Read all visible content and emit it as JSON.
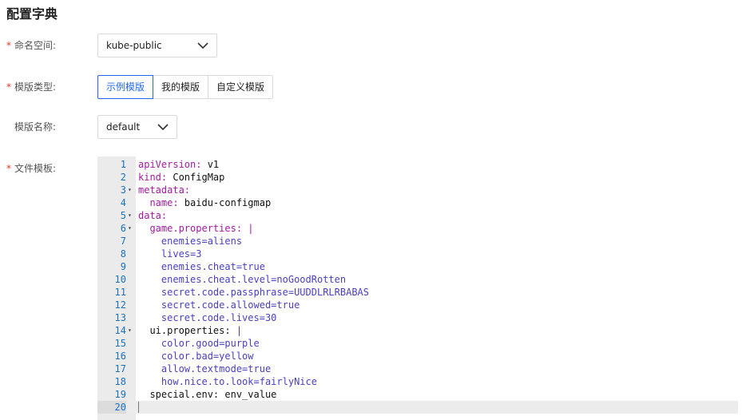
{
  "page": {
    "title": "配置字典"
  },
  "form": {
    "namespace": {
      "label": "命名空间:",
      "value": "kube-public",
      "required": true
    },
    "template_type": {
      "label": "模版类型:",
      "required": true,
      "options": [
        "示例模版",
        "我的模版",
        "自定义模版"
      ],
      "selected": "示例模版"
    },
    "template_name": {
      "label": "模版名称:",
      "value": "default",
      "required": false
    },
    "file_template": {
      "label": "文件模板:",
      "required": true
    }
  },
  "editor": {
    "lines": [
      {
        "n": "1",
        "fold": "",
        "key": "apiVersion:",
        "val": " v1",
        "indent": ""
      },
      {
        "n": "2",
        "fold": "",
        "key": "kind:",
        "val": " ConfigMap",
        "indent": ""
      },
      {
        "n": "3",
        "fold": "▾",
        "key": "metadata:",
        "val": "",
        "indent": ""
      },
      {
        "n": "4",
        "fold": "",
        "key": "name:",
        "val": " baidu-configmap",
        "indent": "  "
      },
      {
        "n": "5",
        "fold": "▾",
        "key": "data:",
        "val": "",
        "indent": ""
      },
      {
        "n": "6",
        "fold": "▾",
        "key": "game.properties: |",
        "val": "",
        "indent": "  "
      },
      {
        "n": "7",
        "fold": "",
        "key": "",
        "val": "enemies=aliens",
        "indent": "    ",
        "plain": true
      },
      {
        "n": "8",
        "fold": "",
        "key": "",
        "val": "lives=3",
        "indent": "    ",
        "plain": true
      },
      {
        "n": "9",
        "fold": "",
        "key": "",
        "val": "enemies.cheat=true",
        "indent": "    ",
        "plain": true
      },
      {
        "n": "10",
        "fold": "",
        "key": "",
        "val": "enemies.cheat.level=noGoodRotten",
        "indent": "    ",
        "plain": true
      },
      {
        "n": "11",
        "fold": "",
        "key": "",
        "val": "secret.code.passphrase=UUDDLRLRBABAS",
        "indent": "    ",
        "plain": true
      },
      {
        "n": "12",
        "fold": "",
        "key": "",
        "val": "secret.code.allowed=true",
        "indent": "    ",
        "plain": true
      },
      {
        "n": "13",
        "fold": "",
        "key": "",
        "val": "secret.code.lives=30",
        "indent": "    ",
        "plain": true
      },
      {
        "n": "14",
        "fold": "▾",
        "key": "",
        "val": "ui.properties: |",
        "indent": "  ",
        "mixed": true
      },
      {
        "n": "15",
        "fold": "",
        "key": "",
        "val": "color.good=purple",
        "indent": "    ",
        "plain": true
      },
      {
        "n": "16",
        "fold": "",
        "key": "",
        "val": "color.bad=yellow",
        "indent": "    ",
        "plain": true
      },
      {
        "n": "17",
        "fold": "",
        "key": "",
        "val": "allow.textmode=true",
        "indent": "    ",
        "plain": true
      },
      {
        "n": "18",
        "fold": "",
        "key": "",
        "val": "how.nice.to.look=fairlyNice",
        "indent": "    ",
        "plain": true
      },
      {
        "n": "19",
        "fold": "",
        "key": "",
        "val": "special.env: env_value",
        "indent": "  ",
        "black": true
      },
      {
        "n": "20",
        "fold": "",
        "key": "",
        "val": "",
        "indent": "",
        "current": true
      }
    ]
  },
  "icons": {
    "chevron": "chevron-down-icon",
    "fold": "fold-arrow-icon"
  }
}
